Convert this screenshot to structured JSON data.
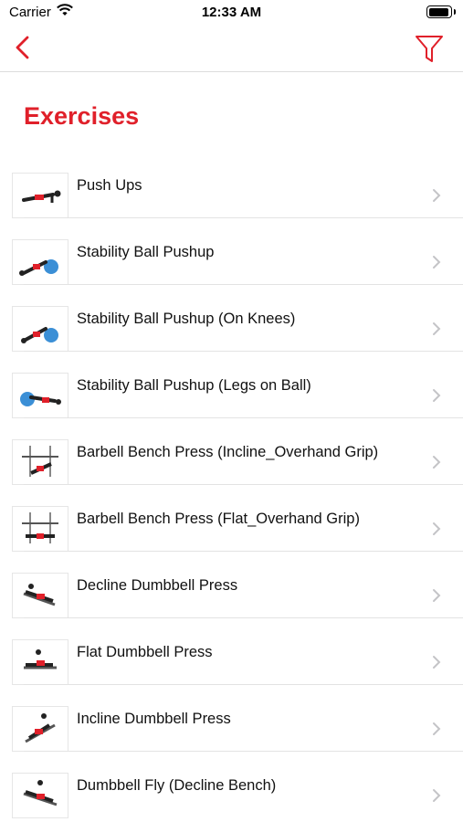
{
  "status_bar": {
    "carrier": "Carrier",
    "time": "12:33 AM"
  },
  "nav": {
    "back_icon": "chevron-left-icon",
    "filter_icon": "funnel-icon",
    "accent_color": "#e0202a"
  },
  "page": {
    "title": "Exercises"
  },
  "exercises": [
    {
      "label": "Push Ups"
    },
    {
      "label": "Stability Ball Pushup"
    },
    {
      "label": "Stability Ball Pushup (On Knees)"
    },
    {
      "label": "Stability Ball Pushup (Legs on Ball)"
    },
    {
      "label": "Barbell Bench Press (Incline_Overhand Grip)"
    },
    {
      "label": "Barbell Bench Press (Flat_Overhand Grip)"
    },
    {
      "label": "Decline Dumbbell Press"
    },
    {
      "label": "Flat Dumbbell Press"
    },
    {
      "label": "Incline Dumbbell Press"
    },
    {
      "label": "Dumbbell Fly (Decline Bench)"
    }
  ]
}
